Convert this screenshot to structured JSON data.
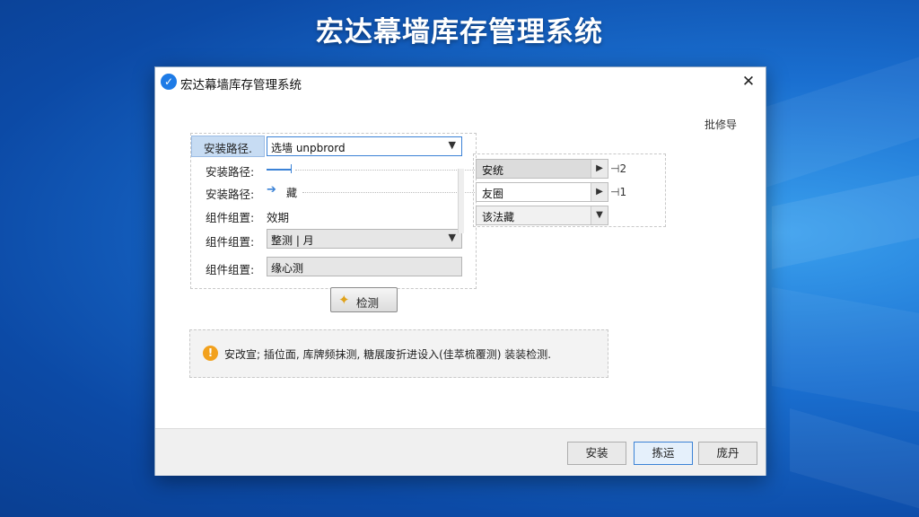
{
  "hero_title": "宏达幕墙库存管理系统",
  "window": {
    "title": "宏达幕墙库存管理系统",
    "close_symbol": "✕",
    "icon": "check-circle-icon"
  },
  "batch_label": "批修导",
  "form": {
    "rows": [
      {
        "label": "安装路径.",
        "value": "选墙 unpbrord"
      },
      {
        "label": "安装路径:"
      },
      {
        "label": "安装路径:",
        "value": "藏"
      },
      {
        "label": "组件组置:",
        "value": "效期"
      },
      {
        "label": "组件组置:",
        "value": "整测 | 月"
      },
      {
        "label": "组件组置:",
        "value": "缘心测"
      }
    ],
    "detect_button": "检测"
  },
  "list": {
    "items": [
      {
        "label": "安统",
        "count": "2"
      },
      {
        "label": "友圈",
        "count": "1"
      },
      {
        "label": "该法藏"
      }
    ]
  },
  "warning": {
    "text": "安改宣; 插位面, 库牌频抹测, 糖展废折进设入(佳萃梳覆测) 装装检测."
  },
  "footer": {
    "buttons": [
      "安装",
      "拣运",
      "庞丹"
    ]
  },
  "colors": {
    "accent": "#3b82d6",
    "warning": "#f2a11d"
  }
}
